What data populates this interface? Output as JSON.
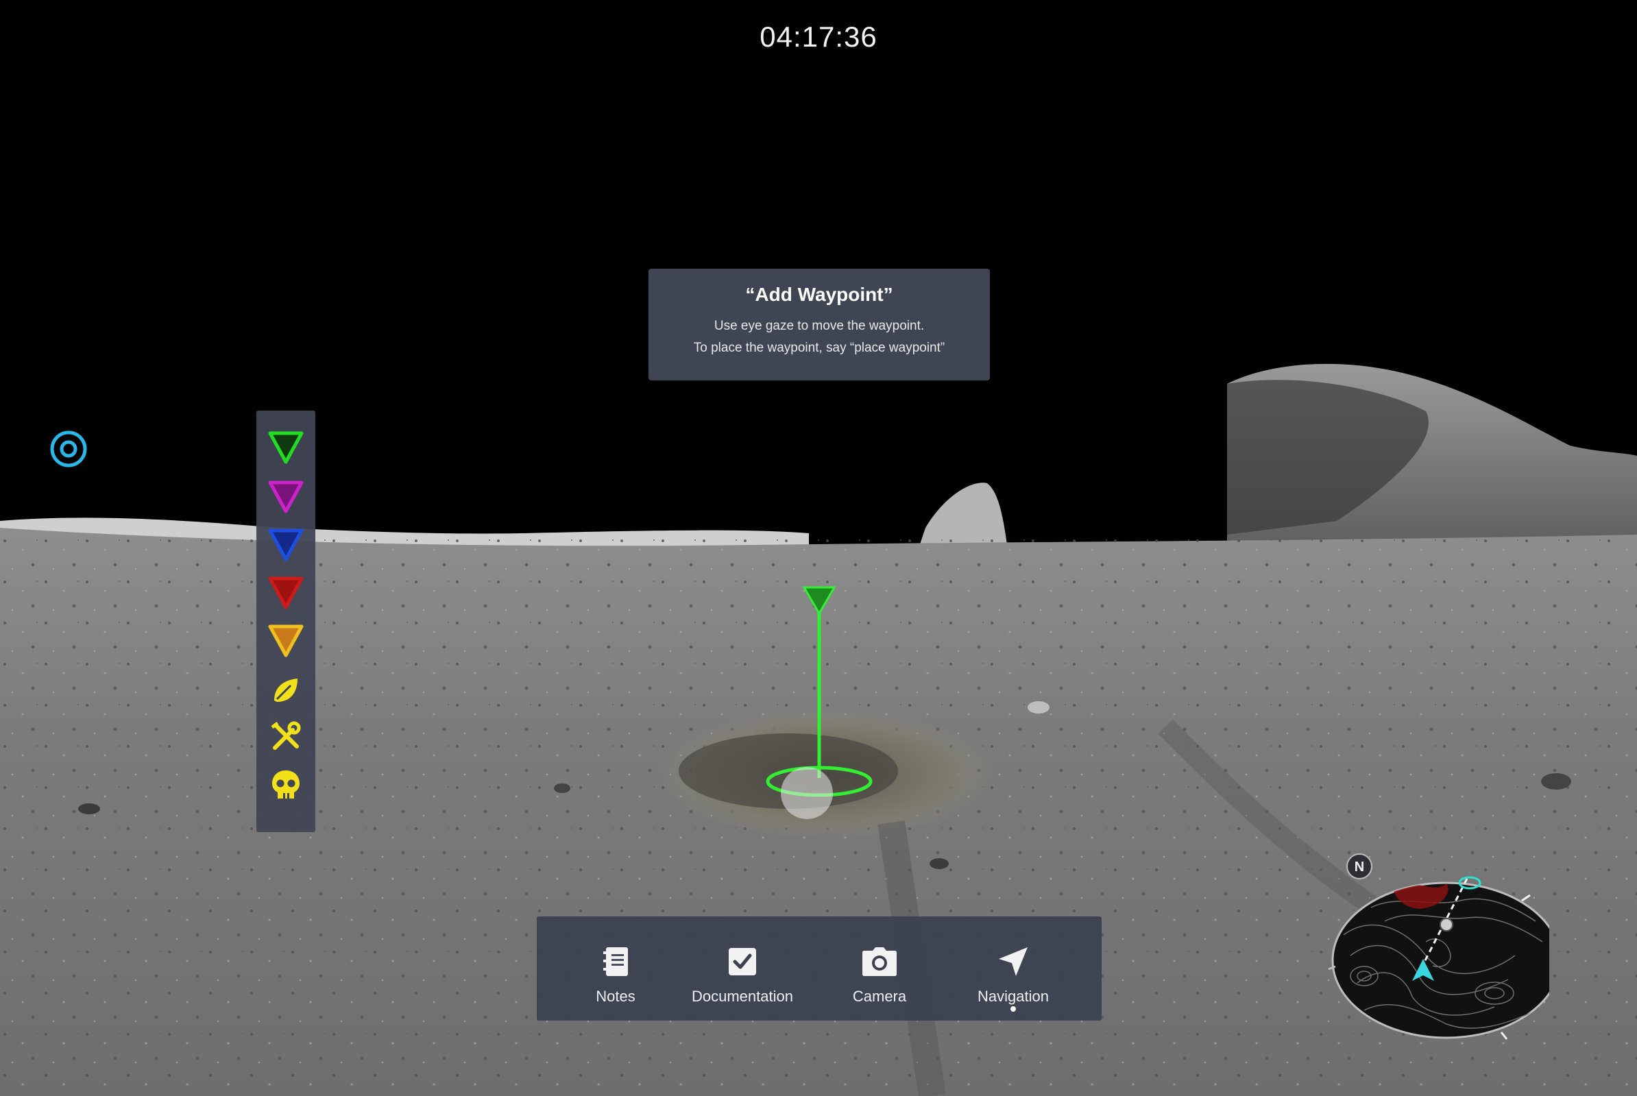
{
  "hud": {
    "clock": "04:17:36"
  },
  "toast": {
    "title": "“Add Waypoint”",
    "line1": "Use eye gaze  to move the waypoint.",
    "line2": "To place the waypoint, say “place waypoint”"
  },
  "palette": {
    "items": [
      {
        "name": "waypoint-green-icon",
        "color": "#22dd22"
      },
      {
        "name": "waypoint-magenta-icon",
        "color": "#cc22cc"
      },
      {
        "name": "waypoint-blue-icon",
        "color": "#1f4fe0"
      },
      {
        "name": "waypoint-red-icon",
        "color": "#cc1b1b"
      },
      {
        "name": "waypoint-orange-icon",
        "color": "#e08a22"
      },
      {
        "name": "leaf-icon",
        "color": "#f2e01a"
      },
      {
        "name": "tools-icon",
        "color": "#f2e01a"
      },
      {
        "name": "skull-icon",
        "color": "#f2e01a"
      }
    ]
  },
  "dock": {
    "notes": "Notes",
    "documentation": "Documentation",
    "camera": "Camera",
    "navigation": "Navigation",
    "active": "Navigation"
  },
  "minimap": {
    "north_label": "N"
  },
  "colors": {
    "accent_cyan": "#29b8e8",
    "waypoint_green": "#33ee33",
    "panel": "#444a58"
  }
}
